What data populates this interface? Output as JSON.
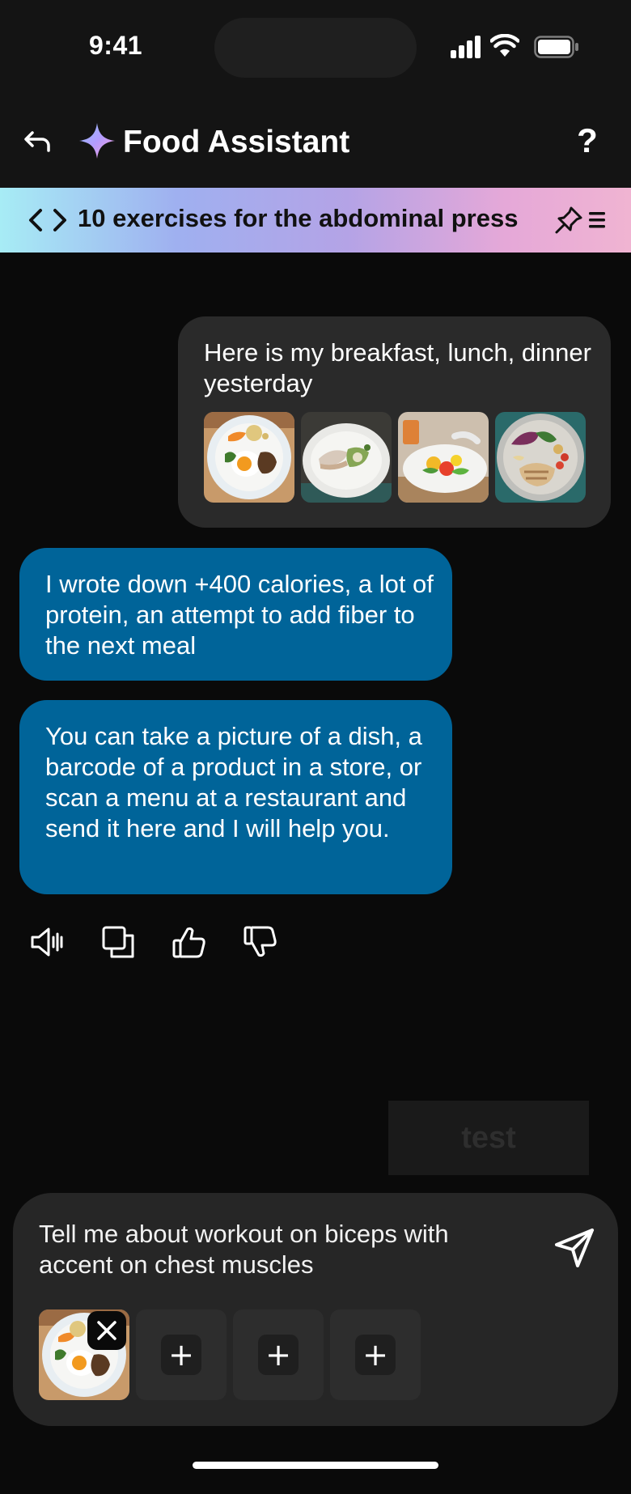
{
  "status_bar": {
    "time": "9:41"
  },
  "header": {
    "title": "Food Assistant",
    "help_label": "?"
  },
  "banner": {
    "title": "10 exercises for the abdominal press"
  },
  "messages": [
    {
      "role": "user",
      "text": "Here is my breakfast, lunch, dinner yesterday",
      "images": [
        "plate-egg-rice",
        "plate-fish-salad",
        "plate-fruit-salad",
        "plate-chicken-greens"
      ]
    },
    {
      "role": "assistant",
      "text": "I wrote down +400 calories, a lot of protein, an attempt to add fiber to the next meal"
    },
    {
      "role": "assistant",
      "text": "You can take a picture of a dish, a barcode of a product in a store, or scan a menu at a restaurant and send it here and I will help you."
    }
  ],
  "test_button": {
    "label": "test"
  },
  "composer": {
    "value": "Tell me about workout on biceps with accent on chest muscles",
    "add_label": "+"
  },
  "colors": {
    "assistant_bubble": "#006499",
    "user_bubble": "#2a2a2a",
    "background": "#0a0a0a"
  }
}
